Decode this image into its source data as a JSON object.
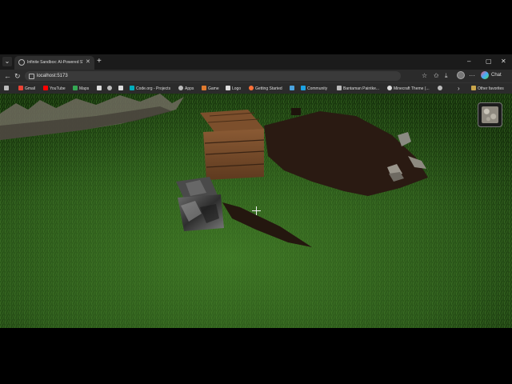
{
  "browser": {
    "tab_title": "Infinite Sandbox: AI-Powered STE",
    "tab_close": "✕",
    "new_tab": "+",
    "url": "localhost:5173",
    "chat_label": "Chat",
    "window_buttons": {
      "minimize": "–",
      "maximize": "▢",
      "close": "✕"
    },
    "nav": {
      "back": "←",
      "reload": "↻"
    }
  },
  "bookmarks": [
    {
      "label": "",
      "icon": "grid-icon",
      "color": "#bbbbbb"
    },
    {
      "label": "Gmail",
      "icon": "gmail-icon",
      "color": "#ea4335"
    },
    {
      "label": "YouTube",
      "icon": "youtube-icon",
      "color": "#ff0000"
    },
    {
      "label": "Maps",
      "icon": "maps-icon",
      "color": "#34a853"
    },
    {
      "label": "",
      "icon": "f-icon",
      "color": "#dddddd"
    },
    {
      "label": "",
      "icon": "globe-icon",
      "color": "#bbbbbb"
    },
    {
      "label": "",
      "icon": "code-icon",
      "color": "#dddddd"
    },
    {
      "label": "Code.org - Projects",
      "icon": "codeorg-icon",
      "color": "#00adbc"
    },
    {
      "label": "Apps",
      "icon": "apps-icon",
      "color": "#bbbbbb"
    },
    {
      "label": "Game",
      "icon": "game-icon",
      "color": "#e07a2e"
    },
    {
      "label": "Logo",
      "icon": "logo-icon",
      "color": "#dddddd"
    },
    {
      "label": "Getting Started",
      "icon": "firefox-icon",
      "color": "#ff7139"
    },
    {
      "label": "",
      "icon": "wave-icon",
      "color": "#4aa3df"
    },
    {
      "label": "Community",
      "icon": "community-icon",
      "color": "#1ba1e2"
    },
    {
      "label": "Bantaman Paintke...",
      "icon": "paint-icon",
      "color": "#bbbbbb"
    },
    {
      "label": "Minecraft Theme (...",
      "icon": "minecraft-icon",
      "color": "#dddddd"
    },
    {
      "label": "",
      "icon": "globe-icon",
      "color": "#bbbbbb"
    }
  ],
  "bookmarks_more": "›",
  "other_favorites": "Other favorites",
  "game": {
    "selected_block": "stone",
    "crosshair": "+",
    "colors": {
      "grass": "#2f5a1c",
      "dirt": "#2a1a12",
      "wood": "#7a5030",
      "stone": "#8f8a80"
    }
  }
}
